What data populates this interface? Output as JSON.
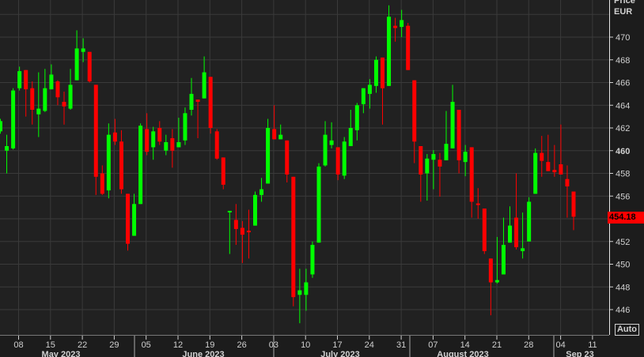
{
  "header": {
    "price_label": "Price",
    "currency": "EUR"
  },
  "last_price": "454.18",
  "auto_button": "Auto",
  "colors": {
    "up": "#00ff00",
    "down": "#ff0000",
    "background": "#212121",
    "grid": "#3a3a3a",
    "last_price_bg": "#ff0000"
  },
  "chart_data": {
    "type": "candlestick",
    "title": "",
    "ylabel": "Price EUR",
    "ylim": [
      444,
      472.5
    ],
    "yticks": [
      446,
      448,
      450,
      452,
      454,
      456,
      458,
      460,
      462,
      464,
      466,
      468,
      470
    ],
    "ytick_bold": 460,
    "grid": true,
    "xticks": [
      "08",
      "15",
      "22",
      "29",
      "05",
      "12",
      "19",
      "26",
      "03",
      "10",
      "17",
      "24",
      "31",
      "07",
      "14",
      "21",
      "28",
      "04",
      "11"
    ],
    "months": [
      "May 2023",
      "June 2023",
      "July 2023",
      "August 2023",
      "Sep 23"
    ],
    "last": 454.18,
    "ohlc": [
      [
        461.7,
        462.8,
        461.5,
        462.6
      ],
      [
        460.0,
        461.4,
        458.0,
        460.4
      ],
      [
        460.2,
        465.5,
        460.1,
        465.3
      ],
      [
        465.5,
        467.4,
        465.3,
        467.0
      ],
      [
        467.1,
        467.1,
        463.0,
        465.4
      ],
      [
        465.5,
        466.1,
        462.3,
        463.6
      ],
      [
        463.2,
        466.9,
        461.2,
        463.7
      ],
      [
        463.5,
        467.2,
        463.4,
        465.5
      ],
      [
        465.4,
        467.6,
        465.4,
        466.7
      ],
      [
        466.1,
        466.2,
        464.0,
        464.7
      ],
      [
        464.3,
        465.2,
        462.3,
        463.9
      ],
      [
        463.7,
        467.2,
        463.6,
        465.8
      ],
      [
        466.2,
        470.6,
        466.2,
        469.0
      ],
      [
        468.7,
        469.9,
        467.8,
        469.0
      ],
      [
        468.7,
        468.7,
        466.0,
        466.1
      ],
      [
        465.8,
        465.8,
        456.1,
        457.7
      ],
      [
        458.0,
        458.7,
        456.1,
        456.2
      ],
      [
        456.5,
        462.4,
        455.8,
        461.4
      ],
      [
        461.6,
        462.8,
        460.5,
        460.8
      ],
      [
        460.8,
        461.8,
        456.2,
        456.6
      ],
      [
        456.2,
        456.2,
        451.2,
        451.8
      ],
      [
        452.5,
        456.2,
        452.5,
        455.3
      ],
      [
        455.3,
        462.4,
        455.3,
        462.2
      ],
      [
        461.9,
        463.3,
        459.6,
        459.9
      ],
      [
        460.3,
        462.1,
        459.2,
        461.7
      ],
      [
        462.0,
        462.6,
        460.5,
        460.8
      ],
      [
        460.0,
        461.4,
        459.6,
        460.75
      ],
      [
        461.1,
        461.9,
        458.5,
        460.0
      ],
      [
        460.3,
        462.9,
        460.3,
        460.75
      ],
      [
        460.9,
        463.8,
        460.5,
        463.3
      ],
      [
        463.6,
        466.4,
        463.1,
        465.0
      ],
      [
        464.5,
        464.5,
        461.1,
        464.3
      ],
      [
        464.6,
        468.3,
        464.6,
        466.9
      ],
      [
        466.5,
        466.5,
        461.5,
        462.0
      ],
      [
        461.7,
        461.9,
        459.2,
        459.3
      ],
      [
        459.4,
        459.4,
        456.6,
        457.0
      ],
      [
        454.6,
        454.7,
        450.9,
        454.7
      ],
      [
        453.9,
        455.3,
        451.7,
        453.1
      ],
      [
        453.2,
        453.8,
        450.1,
        452.6
      ],
      [
        452.95,
        454.8,
        450.5,
        452.9
      ],
      [
        453.4,
        456.4,
        453.4,
        456.1
      ],
      [
        456.1,
        457.6,
        455.5,
        456.6
      ],
      [
        457.1,
        462.8,
        457.1,
        462.0
      ],
      [
        461.9,
        464.0,
        461.0,
        461.0
      ],
      [
        461.0,
        462.3,
        461.0,
        461.4
      ],
      [
        460.9,
        460.9,
        457.2,
        457.9
      ],
      [
        457.7,
        457.7,
        446.3,
        447.1
      ],
      [
        447.3,
        449.6,
        444.8,
        447.7
      ],
      [
        447.3,
        449.6,
        445.9,
        448.4
      ],
      [
        449.1,
        452.0,
        448.8,
        451.7
      ],
      [
        451.9,
        458.9,
        451.9,
        458.6
      ],
      [
        458.7,
        462.6,
        458.6,
        461.4
      ],
      [
        460.5,
        462.5,
        460.2,
        460.9
      ],
      [
        460.3,
        460.3,
        457.4,
        457.9
      ],
      [
        457.8,
        461.2,
        457.5,
        460.8
      ],
      [
        460.4,
        463.6,
        460.4,
        462.0
      ],
      [
        461.8,
        464.2,
        460.9,
        464.0
      ],
      [
        464.1,
        465.5,
        463.3,
        465.5
      ],
      [
        465.0,
        466.3,
        463.7,
        465.8
      ],
      [
        465.7,
        468.3,
        465.1,
        468.0
      ],
      [
        468.2,
        468.2,
        462.3,
        465.5
      ],
      [
        465.7,
        472.8,
        465.7,
        471.8
      ],
      [
        471.0,
        471.7,
        469.6,
        470.8
      ],
      [
        470.9,
        472.4,
        470.0,
        471.5
      ],
      [
        471.0,
        471.25,
        467.1,
        467.1
      ],
      [
        466.2,
        466.2,
        458.9,
        460.8
      ],
      [
        460.4,
        460.4,
        455.5,
        457.9
      ],
      [
        458.0,
        459.7,
        455.6,
        459.3
      ],
      [
        459.2,
        460.05,
        456.6,
        459.7
      ],
      [
        459.2,
        459.8,
        455.95,
        458.6
      ],
      [
        459.15,
        463.5,
        459.15,
        460.6
      ],
      [
        460.2,
        465.8,
        460.2,
        464.3
      ],
      [
        463.6,
        463.6,
        458.0,
        459.15
      ],
      [
        459.0,
        460.5,
        457.75,
        459.9
      ],
      [
        460.3,
        460.3,
        454.1,
        455.5
      ],
      [
        455.35,
        456.7,
        454.0,
        455.3
      ],
      [
        454.9,
        454.9,
        450.9,
        451.15
      ],
      [
        450.5,
        450.5,
        445.5,
        448.4
      ],
      [
        448.4,
        452.4,
        448.3,
        448.6
      ],
      [
        449.1,
        454.1,
        449.1,
        451.7
      ],
      [
        451.9,
        455.1,
        451.9,
        453.4
      ],
      [
        454.1,
        458.0,
        451.3,
        451.5
      ],
      [
        451.15,
        454.55,
        450.5,
        451.4
      ],
      [
        452.0,
        455.9,
        452.0,
        455.5
      ],
      [
        456.2,
        460.2,
        456.2,
        459.8
      ],
      [
        459.8,
        461.3,
        457.7,
        459.1
      ],
      [
        459.0,
        461.4,
        458.2,
        458.2
      ],
      [
        458.3,
        460.5,
        457.7,
        458.1
      ],
      [
        458.8,
        462.3,
        457.9,
        457.9
      ],
      [
        457.5,
        458.7,
        454.1,
        456.85
      ],
      [
        456.4,
        456.4,
        453.0,
        454.18
      ]
    ]
  }
}
